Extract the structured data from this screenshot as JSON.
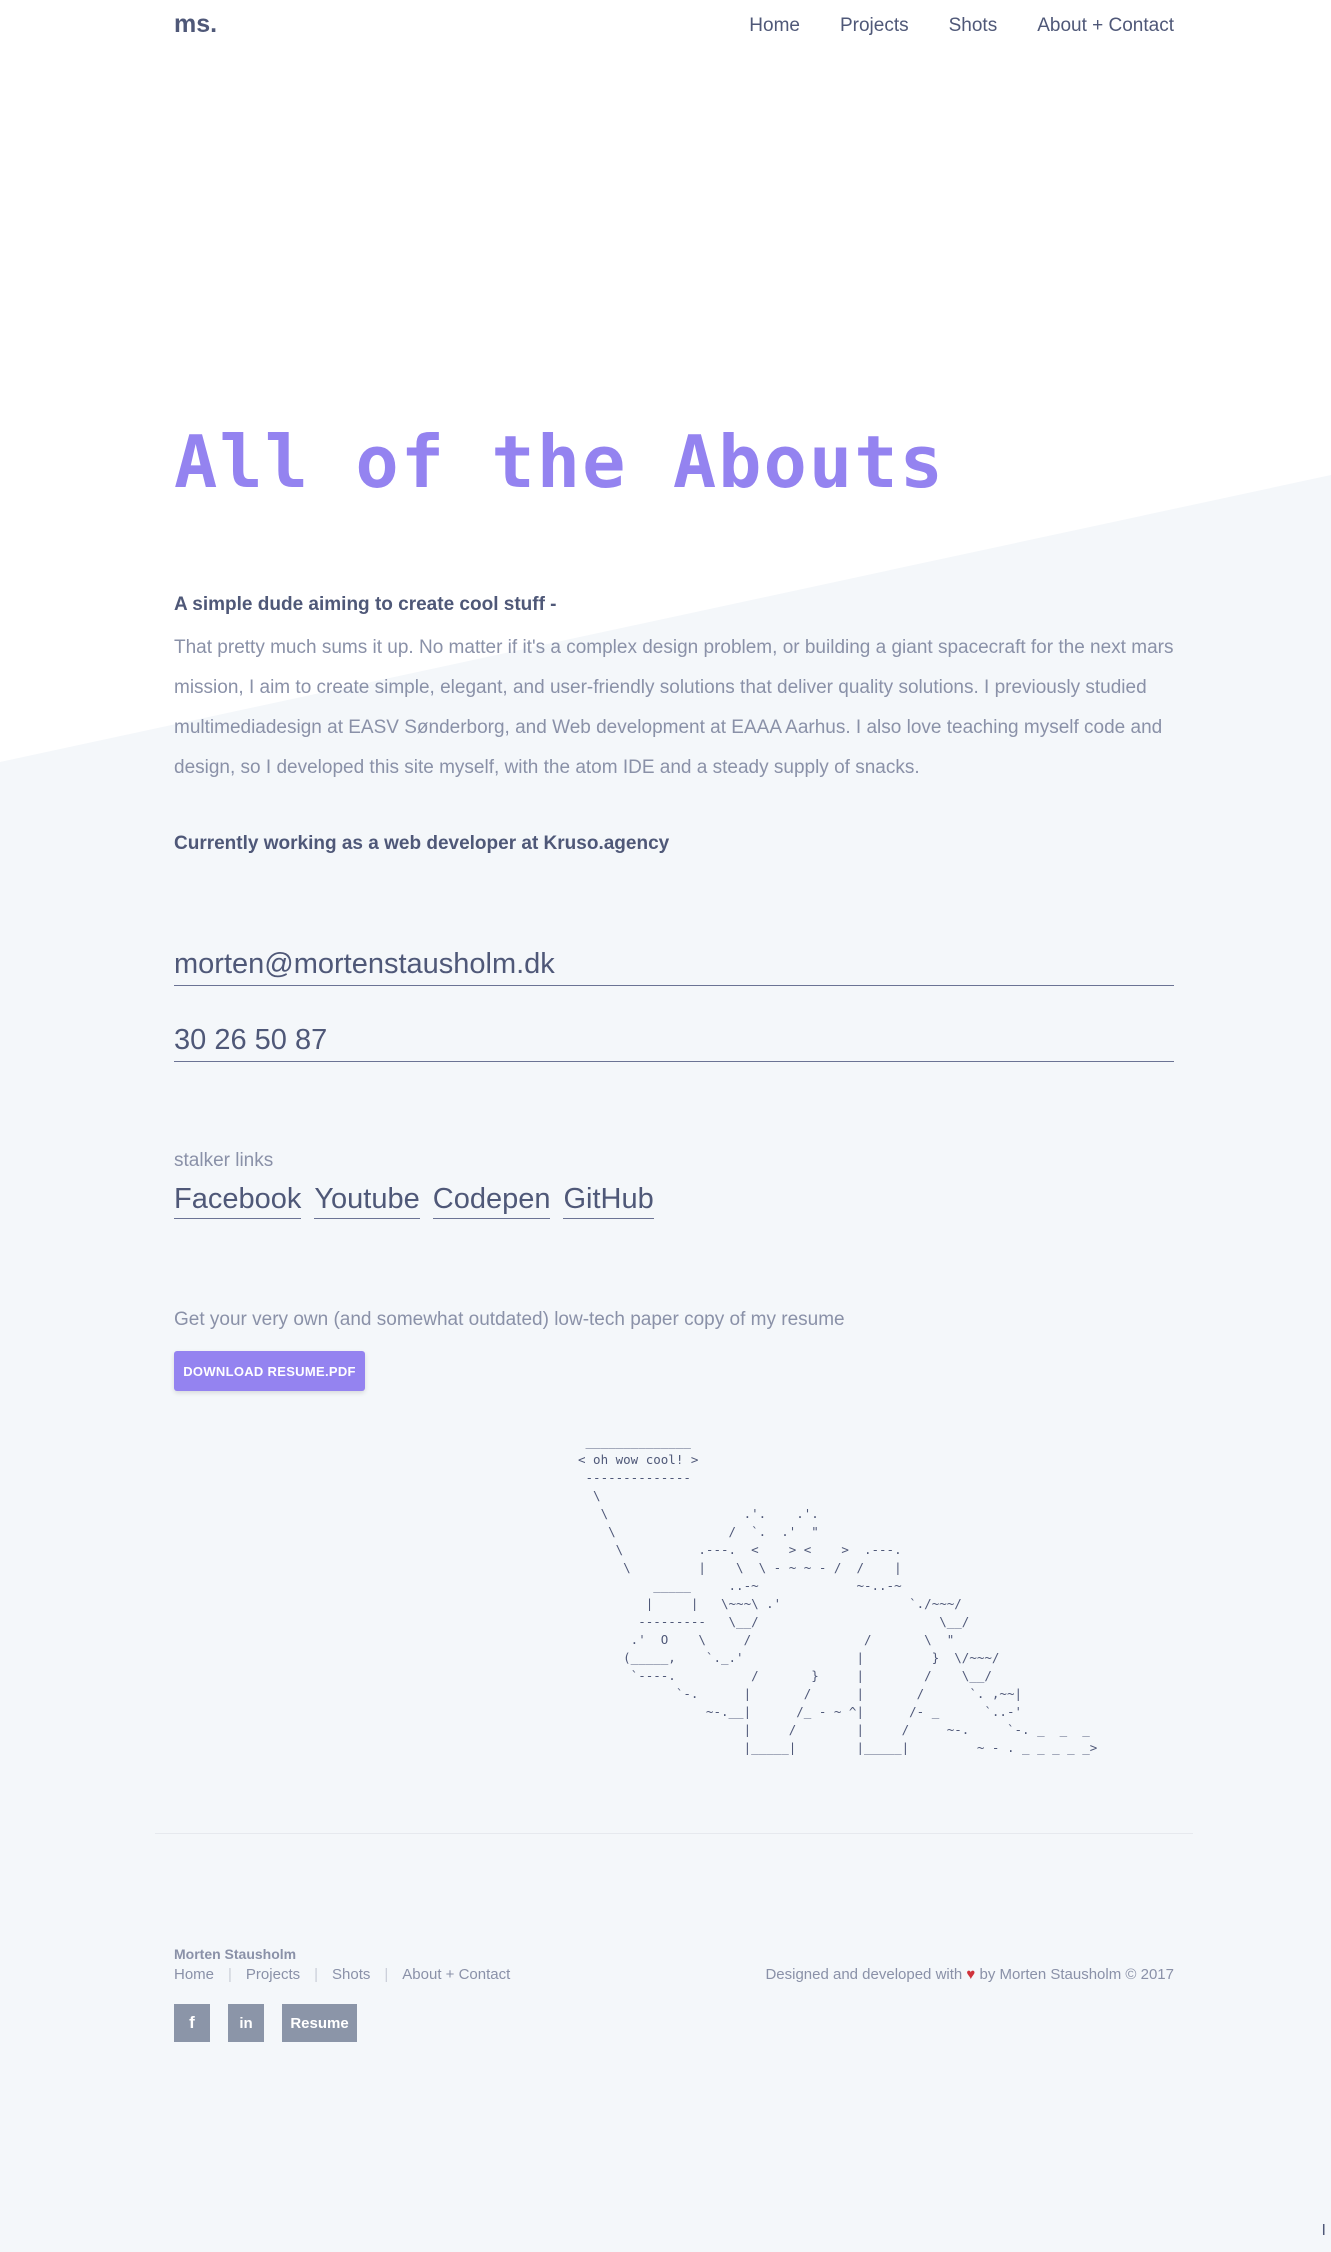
{
  "header": {
    "logo": "ms.",
    "nav": [
      "Home",
      "Projects",
      "Shots",
      "About + Contact"
    ]
  },
  "hero": {
    "title": "All of the Abouts",
    "intro_heading": "A simple dude aiming to create cool stuff -",
    "intro_text": "That pretty much sums it up. No matter if it's a complex design problem, or building a giant spacecraft for the next mars mission, I aim to create simple, elegant, and user-friendly solutions that deliver quality solutions. I previously studied multimediadesign at EASV Sønderborg, and Web development at EAAA Aarhus. I also love teaching myself code and design, so I developed this site myself, with the atom IDE and a steady supply of snacks.",
    "working": "Currently working as a web developer at Kruso.agency"
  },
  "contact": {
    "email": "morten@mortenstausholm.dk",
    "phone": "30 26 50 87"
  },
  "stalker": {
    "label": "stalker links",
    "links": [
      "Facebook",
      "Youtube",
      "Codepen",
      "GitHub"
    ]
  },
  "resume": {
    "text": "Get your very own (and somewhat outdated) low-tech paper copy of my resume",
    "button": "DOWNLOAD RESUME.PDF"
  },
  "ascii_art": " ______________\n< oh wow cool! >\n --------------\n  \\\n   \\                  .'.    .'.\n    \\               /  `.  .'  \"\n     \\          .---.  <    > <    >  .---.\n      \\         |    \\  \\ - ~ ~ - /  /    |\n          _____     ..-~             ~-..-~\n         |     |   \\~~~\\ .'                 `./~~~/\n        ---------   \\__/                        \\__/\n       .'  O    \\     /               /       \\  \"\n      (_____,    `._.'               |         }  \\/~~~/\n       `----.          /       }     |        /    \\__/\n             `-.      |       /      |       /      `. ,~~|\n                 ~-.__|      /_ - ~ ^|      /- _      `..-'\n                      |     /        |     /     ~-.     `-. _  _  _\n                      |_____|        |_____|         ~ - . _ _ _ _ _>",
  "footer": {
    "name": "Morten Stausholm",
    "nav": [
      "Home",
      "Projects",
      "Shots",
      "About + Contact"
    ],
    "credit_pre": "Designed and developed with",
    "heart": "♥",
    "credit_post": "by Morten Stausholm © 2017",
    "social": [
      "f",
      "in"
    ],
    "resume_button": "Resume"
  },
  "cursor": "I"
}
